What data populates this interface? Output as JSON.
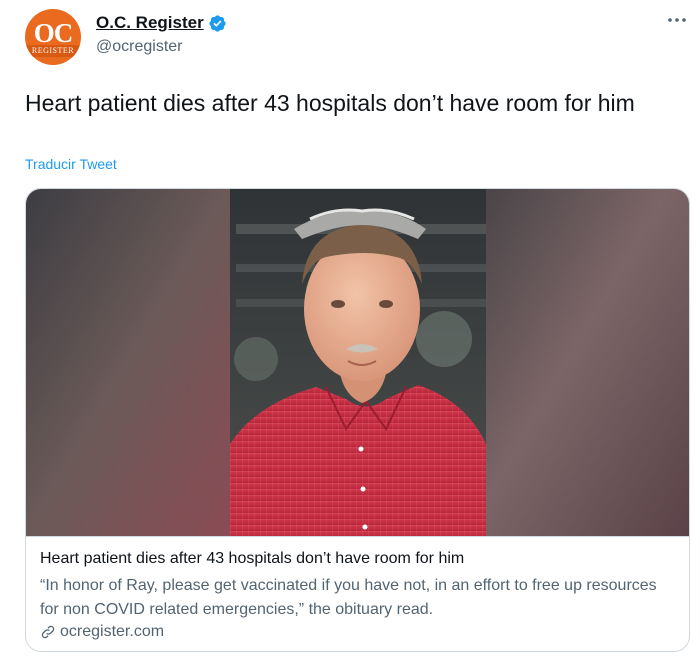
{
  "account": {
    "display_name": "O.C. Register",
    "handle": "@ocregister",
    "avatar_text": "OC",
    "avatar_subtext": "REGISTER",
    "verified": true
  },
  "tweet": {
    "text": "Heart patient dies after 43 hospitals don’t have room for him",
    "translate_label": "Traducir Tweet"
  },
  "card": {
    "title": "Heart patient dies after 43 hospitals don’t have room for him",
    "description": "“In honor of Ray, please get vaccinated if you have not, in an effort to free up resources for non COVID related emergencies,” the obituary read.",
    "domain": "ocregister.com"
  },
  "colors": {
    "brand_orange": "#ea6a1f",
    "verified_blue": "#1d9bf0",
    "link_blue": "#1d9bf0",
    "shirt_red": "#c8283e"
  },
  "icons": {
    "verified": "verified-badge-icon",
    "more": "more-options-icon",
    "link": "link-icon"
  }
}
